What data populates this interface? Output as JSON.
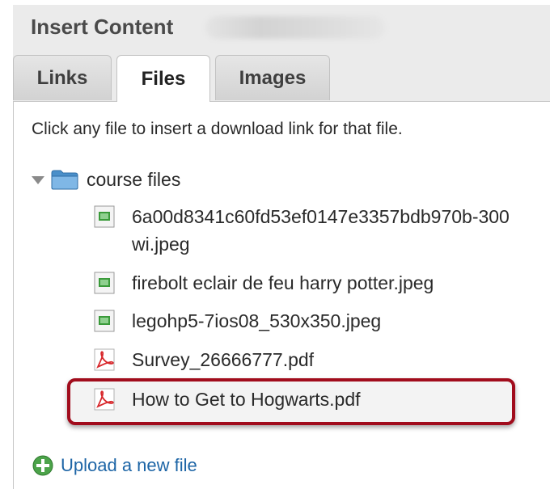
{
  "panel": {
    "title": "Insert Content"
  },
  "tabs": [
    {
      "label": "Links",
      "active": false
    },
    {
      "label": "Files",
      "active": true
    },
    {
      "label": "Images",
      "active": false
    }
  ],
  "files_tab": {
    "instructions": "Click any file to insert a download link for that file.",
    "folder": {
      "name": "course files",
      "expanded": true,
      "icon": "folder-icon",
      "files": [
        {
          "name": "6a00d8341c60fd53ef0147e3357bdb970b-300wi.jpeg",
          "icon": "image-file-icon"
        },
        {
          "name": "firebolt eclair de feu harry potter.jpeg",
          "icon": "image-file-icon"
        },
        {
          "name": "legohp5-7ios08_530x350.jpeg",
          "icon": "image-file-icon"
        },
        {
          "name": "Survey_26666777.pdf",
          "icon": "pdf-file-icon"
        },
        {
          "name": "How to Get to Hogwarts.pdf",
          "icon": "pdf-file-icon",
          "highlighted": true
        }
      ]
    },
    "upload_label": "Upload a new file"
  },
  "colors": {
    "highlight_border": "#a10c1c",
    "link": "#1d65a6",
    "upload_icon": "#4ca34a",
    "folder": "#4a8fc9",
    "pdf": "#d8282c",
    "image_file": "#3a9a3a"
  }
}
